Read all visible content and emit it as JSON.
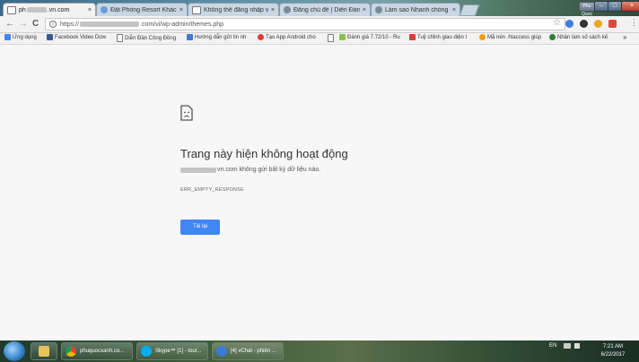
{
  "tabs": [
    {
      "label": "ph",
      "label_tail": ".vn.com",
      "close": "×",
      "active": true
    },
    {
      "label": "Đặt Phòng Resort Khách",
      "close": "×",
      "active": false
    },
    {
      "label": "Không thể đăng nhập v",
      "close": "×",
      "active": false
    },
    {
      "label": "Đăng chủ đề | Diễn Đàn",
      "close": "×",
      "active": false
    },
    {
      "label": "Làm sao Nhanh chóng h",
      "close": "×",
      "active": false
    }
  ],
  "window": {
    "profile": "Phu Quoc",
    "minimize": "–",
    "maximize": "□",
    "close": "×"
  },
  "toolbar": {
    "back": "←",
    "forward": "→",
    "reload": "C",
    "url_scheme": "https://",
    "url_path": ".com/vi/wp-admin/themes.php",
    "star": "☆",
    "menu": "⋮"
  },
  "bookmarks": [
    {
      "label": "Ứng dụng",
      "icon": "apps-icon",
      "color": "#4285f4"
    },
    {
      "label": "Facebook Video Dow",
      "icon": "facebook-icon",
      "color": "#3b5998"
    },
    {
      "label": "Diễn Đàn Công Đồng",
      "icon": "page-icon",
      "color": "#ffffff"
    },
    {
      "label": "Hướng dẫn gửi tin nh",
      "icon": "download-icon",
      "color": "#3a7bd5"
    },
    {
      "label": "Tạo App Android cho",
      "icon": "android-icon",
      "color": "#e53935"
    },
    {
      "label": "",
      "icon": "page-icon",
      "color": "#ffffff"
    },
    {
      "label": "Đánh giá 7.72/10 - Ru",
      "icon": "rating-icon",
      "color": "#8bc34a"
    },
    {
      "label": "Tuỷ chỉnh giao diện t",
      "icon": "youtube-icon",
      "color": "#e53935"
    },
    {
      "label": "Mã nén .htaccess giúp",
      "icon": "compress-icon",
      "color": "#f39c12"
    },
    {
      "label": "Nhân làm số sách kế",
      "icon": "globe-icon",
      "color": "#2e7d32"
    },
    {
      "label": "»",
      "icon": "more-icon",
      "color": "#555555"
    }
  ],
  "error": {
    "title": "Trang này hiện không hoạt động",
    "domain_tail": "vn.com",
    "message": "không gửi bất kỳ dữ liệu nào.",
    "code": "ERR_EMPTY_RESPONSE",
    "reload_label": "Tải lại"
  },
  "taskbar": {
    "items": [
      {
        "label": "",
        "icon": "explorer-icon"
      },
      {
        "label": "phuquocxanh.co...",
        "icon": "chrome-icon"
      },
      {
        "label": "Skype™ [1] - tour...",
        "icon": "skype-icon"
      },
      {
        "label": "[4] vChat - phiên ...",
        "icon": "vchat-icon"
      }
    ],
    "lang": "EN",
    "time": "7:21 AM",
    "date": "6/22/2017"
  },
  "colors": {
    "accent": "#4285f4",
    "content_bg": "#f7f7f7",
    "chrome_bg": "#f2f2f2"
  }
}
